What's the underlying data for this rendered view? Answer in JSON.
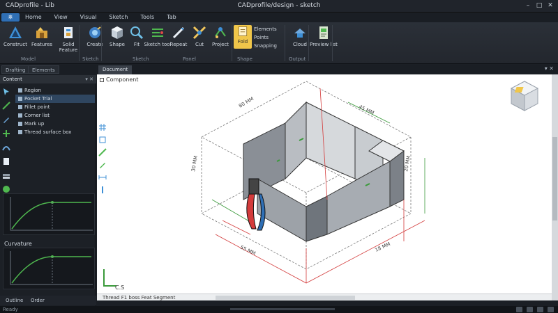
{
  "window": {
    "app_title": "CADprofile - Lib",
    "doc_title": "CADprofile/design - sketch",
    "controls": [
      "–",
      "□",
      "✕"
    ]
  },
  "menu": {
    "app_button": "⎈",
    "items": [
      "Home",
      "View",
      "Visual",
      "Sketch",
      "Tools",
      "Tab"
    ]
  },
  "ribbon": {
    "buttons": [
      {
        "label": "Construct",
        "icon": "construct-icon"
      },
      {
        "label": "Features",
        "icon": "features-icon"
      },
      {
        "label": "Solid Feature",
        "icon": "solid-feature-icon"
      },
      {
        "label": "Create",
        "icon": "create-icon"
      },
      {
        "label": "Shape",
        "icon": "shape-icon"
      },
      {
        "label": "Fit",
        "icon": "fit-icon"
      },
      {
        "label": "Sketch tool",
        "icon": "sketch-tool-icon"
      },
      {
        "label": "Repeat",
        "icon": "repeat-icon"
      },
      {
        "label": "Cut",
        "icon": "cut-icon"
      },
      {
        "label": "Project",
        "icon": "project-icon"
      },
      {
        "label": "Fold",
        "icon": "fold-icon"
      },
      {
        "label": "Cloud",
        "icon": "cloud-icon"
      },
      {
        "label": "Preview list",
        "icon": "preview-icon"
      }
    ],
    "small_stack": [
      "Elements",
      "Points",
      "Snapping"
    ],
    "groups": [
      "Model",
      "Sketch",
      "Sketch",
      "Panel",
      "Shape",
      "Output"
    ]
  },
  "left_panel": {
    "tabs": [
      "Drafting",
      "Elements"
    ],
    "header": "Content",
    "tree_items": [
      "Region",
      "Pocket Trial",
      "Fillet point",
      "Corner list",
      "Mark up",
      "Thread surface box"
    ],
    "curve_panel_title": "Curvature",
    "bottom_tabs": [
      "Outline",
      "Order"
    ]
  },
  "viewport": {
    "tab": "Document",
    "header": "Component",
    "axis_label": "C.S",
    "status_text": "Thread F1 boss Feat Segment"
  },
  "statusbar": {
    "left_text": "Ready"
  },
  "colors": {
    "accent": "#f0c64a",
    "dim_red": "#d33b3b",
    "dim_green": "#3a9a3a",
    "curve_green": "#4fb84f"
  }
}
